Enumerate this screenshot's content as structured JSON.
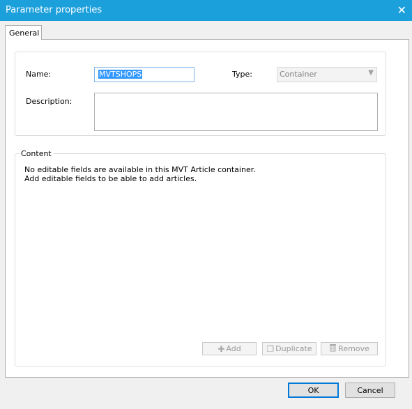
{
  "window": {
    "title": "Parameter properties",
    "close_glyph": "✕"
  },
  "tabs": [
    {
      "label": "General"
    }
  ],
  "general": {
    "name_label": "Name:",
    "name_value": "MVTSHOPS",
    "type_label": "Type:",
    "type_value": "Container",
    "description_label": "Description:",
    "description_value": ""
  },
  "content": {
    "legend": "Content",
    "message_line1": "No editable fields are available in this MVT Article container.",
    "message_line2": "Add editable fields to be able to add articles.",
    "add_label": "Add",
    "duplicate_label": "Duplicate",
    "remove_label": "Remove"
  },
  "dialog": {
    "ok_label": "OK",
    "cancel_label": "Cancel"
  },
  "colors": {
    "titlebar": "#1ca0dc",
    "selection": "#3399ff",
    "focus_border": "#0078d7"
  },
  "icons": {
    "close": "close-icon",
    "add": "plus-icon",
    "duplicate": "duplicate-icon",
    "remove": "trash-icon",
    "dropdown": "chevron-down-icon"
  }
}
